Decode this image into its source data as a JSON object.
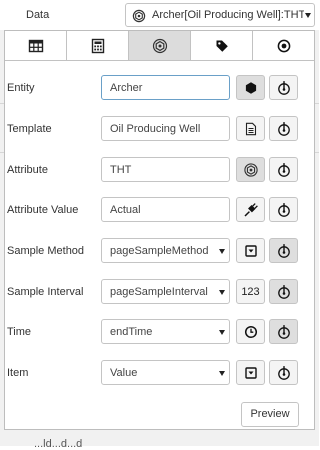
{
  "header": {
    "label": "Data",
    "select_value": "Archer[Oil Producing Well]:THT",
    "select_icon": "element-icon"
  },
  "tabs": [
    {
      "icon": "table-icon",
      "active": false
    },
    {
      "icon": "calculator-icon",
      "active": false
    },
    {
      "icon": "element-icon",
      "active": true
    },
    {
      "icon": "tag-icon",
      "active": false
    },
    {
      "icon": "radio-target-icon",
      "active": false
    }
  ],
  "form": {
    "entity": {
      "label": "Entity",
      "value": "Archer"
    },
    "template": {
      "label": "Template",
      "value": "Oil Producing Well"
    },
    "attribute": {
      "label": "Attribute",
      "value": "THT"
    },
    "attribute_value": {
      "label": "Attribute Value",
      "value": "Actual"
    },
    "sample_method": {
      "label": "Sample Method",
      "value": "pageSampleMethod"
    },
    "sample_interval": {
      "label": "Sample Interval",
      "value": "pageSampleInterval",
      "button_text": "123"
    },
    "time": {
      "label": "Time",
      "value": "endTime"
    },
    "item": {
      "label": "Item",
      "value": "Value"
    }
  },
  "preview_button": "Preview",
  "bottom_text": "...ld...d...d"
}
